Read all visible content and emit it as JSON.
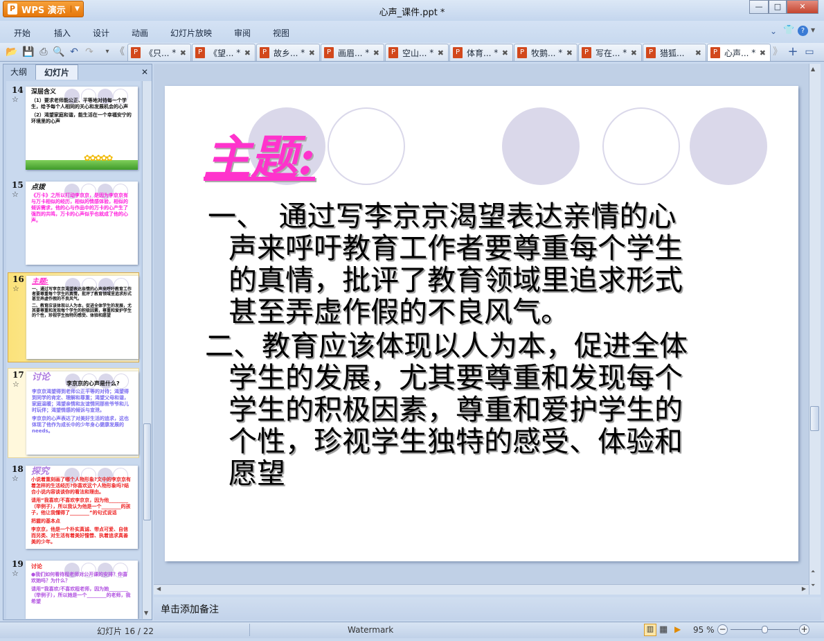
{
  "app": {
    "name": "WPS 演示",
    "window_title": "心声_课件.ppt *"
  },
  "window_controls": {
    "minimize": "—",
    "maximize": "□",
    "close": "✕"
  },
  "menu": [
    "开始",
    "插入",
    "设计",
    "动画",
    "幻灯片放映",
    "审阅",
    "视图"
  ],
  "doc_tabs": [
    {
      "label": "《只...",
      "modified": "*"
    },
    {
      "label": "《望...",
      "modified": "*"
    },
    {
      "label": "故乡...",
      "modified": "*"
    },
    {
      "label": "画眉...",
      "modified": "*"
    },
    {
      "label": "空山...",
      "modified": "*"
    },
    {
      "label": "体育...",
      "modified": "*"
    },
    {
      "label": "牧鹅...",
      "modified": "*"
    },
    {
      "label": "写在...",
      "modified": "*"
    },
    {
      "label": "猎狐...",
      "modified": ""
    },
    {
      "label": "心声...",
      "modified": "*",
      "active": true
    }
  ],
  "left_panel": {
    "tabs": [
      "大纲",
      "幻灯片"
    ],
    "close": "✕"
  },
  "thumbnails": [
    {
      "num": "14",
      "title": "深层含义",
      "lines": [
        "（1）要求老师能公正、平等地对待每一个学生，给予每个人相同的关心和发展机会的心声",
        "（2）渴望家庭和谐，能生活在一个幸福安宁的环境里的心声"
      ]
    },
    {
      "num": "15",
      "title": "点拨",
      "lines": [
        "《万卡》之所以打动李京京，是因为李京京有与万卡相似的经历，相似的情感体验，相似的倾诉需求，他的心与作品中的万卡的心产生了强烈的共鸣，万卡的心声似乎也就成了他的心声。"
      ]
    },
    {
      "num": "16",
      "title": "主题:",
      "lines": [
        "一、通过写李京京渴望表达亲情的心声来呼吁教育工作者要尊重每个学生的真情，批评了教育领域里追求形式甚至弄虚作假的不良风气。",
        "二、教育应该体现以人为本，促进全体学生的发展，尤其要尊重和发现每个学生的积极因素，尊重和爱护学生的个性，珍视学生独特的感受、体验和愿望"
      ]
    },
    {
      "num": "17",
      "title": "讨论",
      "subtitle": "李京京的心声是什么?",
      "lines": [
        "李京京渴望得到老师公正平等的对待；渴望得到同学的肯定、理解和尊重；渴望父母和谐，家庭温暖；渴望亲情和友谊情同那些爷爷和儿时玩伴；渴望情感的倾诉与宣泄。",
        "李京京的心声表达了对美好生活的追求，这也体现了他作为成长中的少年身心健康发展的needs。"
      ]
    },
    {
      "num": "18",
      "title": "探究",
      "lines": [
        "小说着重刻画了哪个人物形象?文中的李京京有着怎样的生活经历?你喜欢这个人物形象吗?结合小说内容谈谈你的看法和理由。",
        "请用“我喜欢/不喜欢李京京，因为他________（举例子），所以我认为他是一个________的孩子，他让我懂得了________”的句式说话",
        "把握的基本点",
        "李京京，他是一个朴实真诚、带点可爱、自信而另类、对生活有着美好憧憬、执着追求真善美的少年。"
      ]
    },
    {
      "num": "19",
      "title": "讨论",
      "lines": [
        "●我们如何看待程老师对公开课的安排？你喜欢她吗？为什么？",
        "请用“我喜欢/不喜欢程老师，因为她________（举例子），所以她是一个________的老师，我希望"
      ]
    }
  ],
  "slide": {
    "title": "主题:",
    "paragraphs": [
      [
        "一、　通过写李京京渴望表达亲情的心",
        "声来呼吁教育工作者要尊重每个学生",
        "的真情，批评了教育领域里追求形式",
        "甚至弄虚作假的不良风气。"
      ],
      [
        "二、教育应该体现以人为本，促进全体",
        "学生的发展，尤其要尊重和发现每个",
        "学生的积极因素，尊重和爱护学生的",
        "个性，珍视学生独特的感受、体验和",
        "愿望"
      ]
    ]
  },
  "notes_placeholder": "单击添加备注",
  "status": {
    "slide_counter": "幻灯片 16 / 22",
    "template": "Watermark",
    "zoom": "95 %",
    "zoom_fraction": 0.5
  },
  "colors": {
    "title": "#ff33cc",
    "accent": "#e5760a",
    "circle": "#dad8ea"
  }
}
